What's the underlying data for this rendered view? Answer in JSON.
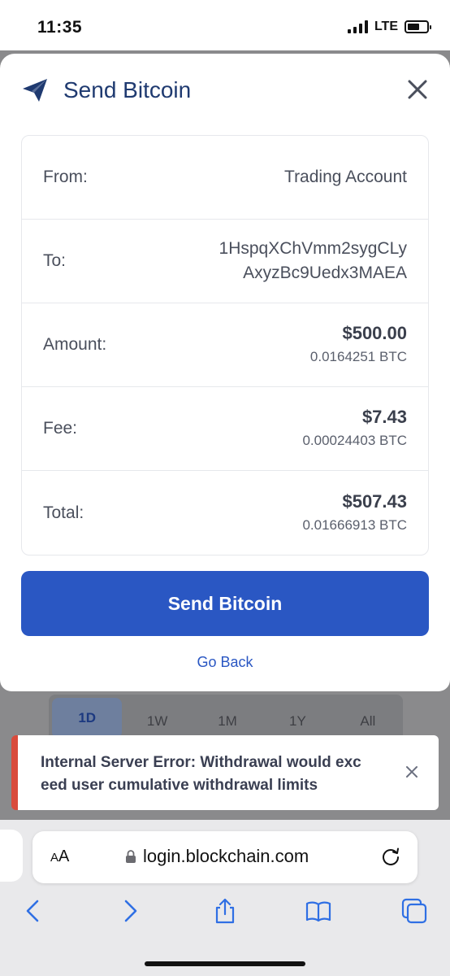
{
  "status_bar": {
    "time": "11:35",
    "network": "LTE"
  },
  "modal": {
    "title": "Send Bitcoin",
    "rows": [
      {
        "label": "From:",
        "value": "Trading Account"
      },
      {
        "label": "To:",
        "value_line1": "1HspqXChVmm2sygCLy",
        "value_line2": "AxyzBc9Uedx3MAEA"
      },
      {
        "label": "Amount:",
        "fiat": "$500.00",
        "crypto": "0.0164251 BTC"
      },
      {
        "label": "Fee:",
        "fiat": "$7.43",
        "crypto": "0.00024403 BTC"
      },
      {
        "label": "Total:",
        "fiat": "$507.43",
        "crypto": "0.01666913 BTC"
      }
    ],
    "send_button_label": "Send Bitcoin",
    "go_back_label": "Go Back"
  },
  "timeframe_tabs": [
    "1D",
    "1W",
    "1M",
    "1Y",
    "All"
  ],
  "toast": {
    "message": "Internal Server Error: Withdrawal would exc eed user cumulative withdrawal limits"
  },
  "browser": {
    "aa_large": "A",
    "aa_small": "A",
    "url": "login.blockchain.com"
  },
  "colors": {
    "accent": "#2a57c3",
    "title": "#1f3a70",
    "error": "#d94b3c"
  },
  "icons": [
    "paper-plane-icon",
    "close-icon",
    "lock-icon",
    "reload-icon",
    "back-icon",
    "forward-icon",
    "share-icon",
    "bookmarks-icon",
    "tabs-icon"
  ]
}
